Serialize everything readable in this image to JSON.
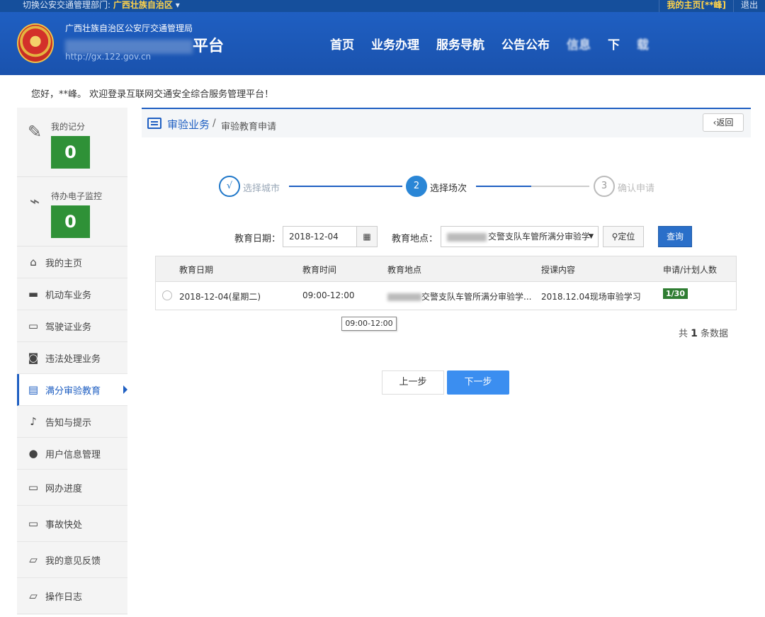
{
  "topbar": {
    "switch_label": "切换公安交通管理部门:",
    "current_region": "广西壮族自治区",
    "my_home": "我的主页[**峰]",
    "logout": "退出"
  },
  "header": {
    "org_name": "广西壮族自治区公安厅交通管理局",
    "site_title": "平台",
    "url": "http://gx.122.gov.cn",
    "nav": [
      "首页",
      "业务办理",
      "服务导航",
      "公告公布",
      "信息",
      "下",
      "载"
    ]
  },
  "welcome": "您好，**峰。 欢迎登录互联网交通安全综合服务管理平台！",
  "sidebar": {
    "score": {
      "label": "我的记分",
      "value": "0"
    },
    "monitor": {
      "label": "待办电子监控",
      "value": "0"
    },
    "items": [
      {
        "label": "我的主页",
        "icon": "home-icon",
        "glyph": "⌂"
      },
      {
        "label": "机动车业务",
        "icon": "truck-icon",
        "glyph": "▬"
      },
      {
        "label": "驾驶证业务",
        "icon": "card-icon",
        "glyph": "▭"
      },
      {
        "label": "违法处理业务",
        "icon": "camera-icon",
        "glyph": "◙"
      },
      {
        "label": "满分审验教育",
        "icon": "list-icon",
        "glyph": "▤"
      },
      {
        "label": "告知与提示",
        "icon": "bell-icon",
        "glyph": "♪"
      },
      {
        "label": "用户信息管理",
        "icon": "user-icon",
        "glyph": "●"
      },
      {
        "label": "网办进度",
        "icon": "progress-icon",
        "glyph": "▭"
      },
      {
        "label": "事故快处",
        "icon": "accident-icon",
        "glyph": "▭"
      },
      {
        "label": "我的意见反馈",
        "icon": "feedback-icon",
        "glyph": "▱"
      },
      {
        "label": "操作日志",
        "icon": "log-icon",
        "glyph": "▱"
      }
    ]
  },
  "panel": {
    "crumb_main": "审验业务",
    "crumb_sep": "/",
    "crumb_sub": "审验教育申请",
    "back": "‹返回"
  },
  "steps": [
    {
      "num": "√",
      "label": "选择城市"
    },
    {
      "num": "2",
      "label": "选择场次"
    },
    {
      "num": "3",
      "label": "确认申请"
    }
  ],
  "filters": {
    "date_label": "教育日期：",
    "date_value": "2018-12-04",
    "location_label": "教育地点：",
    "location_value": "交警支队车管所满分审验学",
    "locate_btn": "定位",
    "query_btn": "查询"
  },
  "table": {
    "headers": [
      "教育日期",
      "教育时间",
      "教育地点",
      "授课内容",
      "申请/计划人数"
    ],
    "rows": [
      {
        "date": "2018-12-04(星期二)",
        "time": "09:00-12:00",
        "location": "交警支队车管所满分审验学...",
        "content": "2018.12.04现场审验学习",
        "ratio": "1/30"
      }
    ]
  },
  "tooltip": "09:00-12:00",
  "total": {
    "prefix": "共",
    "count": "1",
    "suffix": "条数据"
  },
  "buttons": {
    "prev": "上一步",
    "next": "下一步"
  },
  "colors": {
    "header_blue": "#1f5fc2",
    "score_green": "#2f9137",
    "next_btn": "#3b8ef0"
  }
}
